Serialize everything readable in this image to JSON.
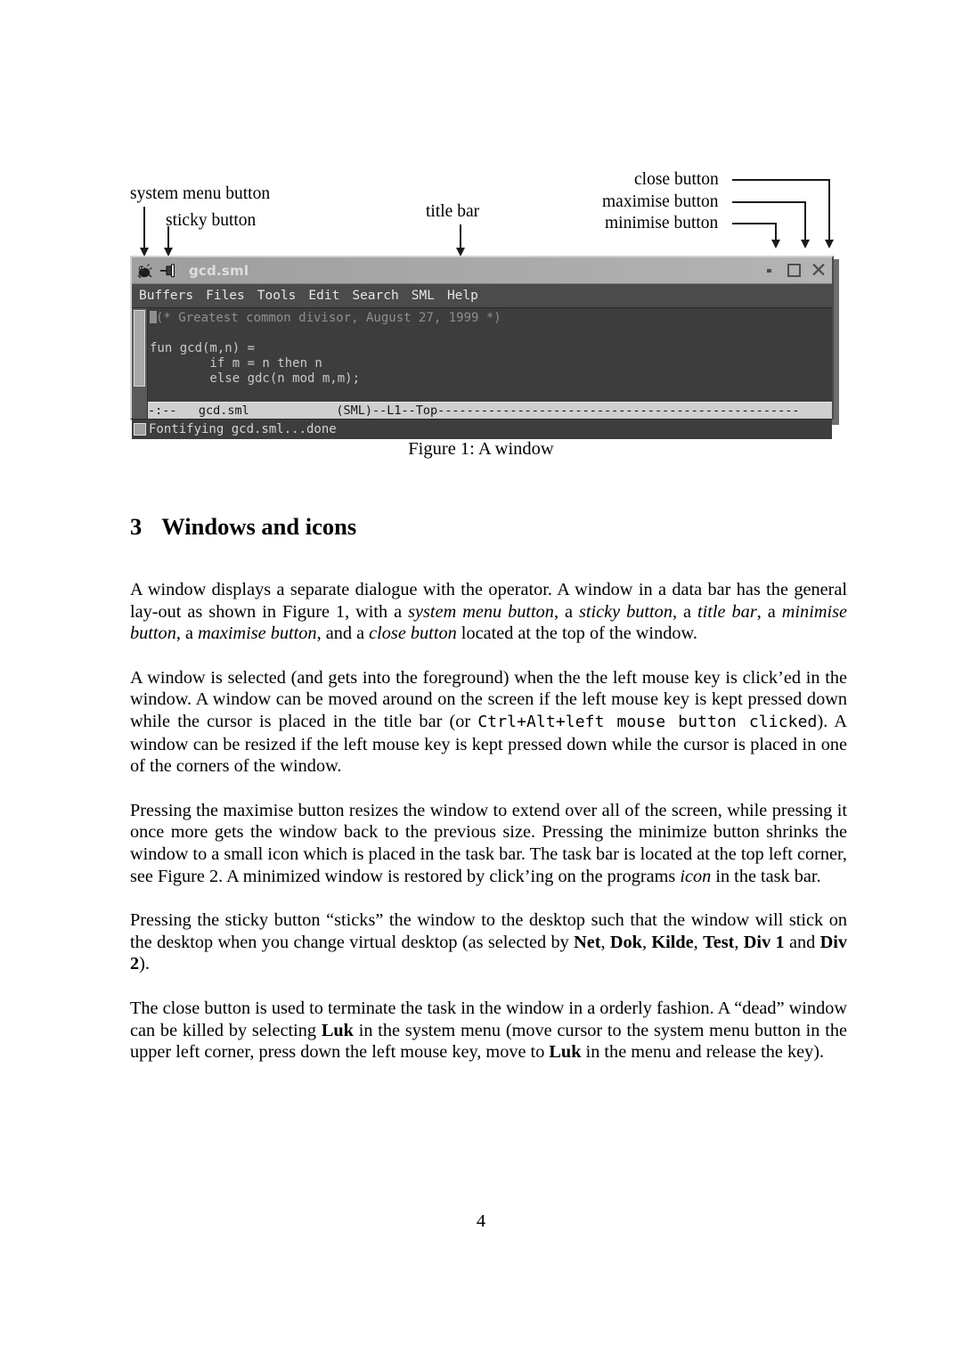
{
  "figure": {
    "annotations": {
      "system_menu": "system menu button",
      "sticky": "sticky button",
      "title_bar": "title bar",
      "close": "close button",
      "maximise": "maximise button",
      "minimise": "minimise button"
    },
    "caption": "Figure 1: A window",
    "window": {
      "title": "gcd.sml",
      "sysmenu_icon": "gnu-emacs-icon",
      "sticky_icon": "pushpin-icon",
      "minimise_icon": "minimise-icon",
      "maximise_icon": "maximise-icon",
      "close_icon": "close-icon",
      "menus": [
        "Buffers",
        "Files",
        "Tools",
        "Edit",
        "Search",
        "SML",
        "Help"
      ],
      "code": {
        "comment": "(* Greatest common divisor, August 27, 1999 *)",
        "lines": [
          "fun gcd(m,n) =",
          "        if m = n then n",
          "        else gdc(n mod m,m);"
        ]
      },
      "modeline": "-:--   gcd.sml            (SML)--L1--Top--------------------------------------------------",
      "minibuffer": "Fontifying gcd.sml...done"
    }
  },
  "section": {
    "number": "3",
    "title": "Windows and icons"
  },
  "paragraphs": {
    "p1": {
      "a": "A window displays a separate dialogue with the operator. A window in a data bar has the general lay-out as shown in Figure 1, with a ",
      "i1": "system menu button",
      "b": ", a ",
      "i2": "sticky button",
      "c": ", a ",
      "i3": "title bar",
      "d": ", a ",
      "i4": "minimise button",
      "e": ", a ",
      "i5": "maximise button",
      "f": ", and a ",
      "i6": "close button",
      "g": " located at the top of the window."
    },
    "p2": {
      "a": "A window is selected (and gets into the foreground) when the the left mouse key is click’ed in the window. A window can be moved around on the screen if the left mouse key is kept pressed down while the cursor is placed in the title bar (or ",
      "mono": "Ctrl+Alt+left mouse button clicked",
      "b": "). A window can be resized if the left mouse key is kept pressed down while the cursor is placed in one of the corners of the window."
    },
    "p3": {
      "a": "Pressing the maximise button resizes the window to extend over all of the screen, while pressing it once more gets the window back to the previous size. Pressing the minimize button shrinks the window to a small icon which is placed in the task bar. The task bar is located at the top left corner, see Figure 2. A minimized window is restored by click’ing on the programs ",
      "i1": "icon",
      "b": " in the task bar."
    },
    "p4": {
      "a": "Pressing the sticky button “sticks” the window to the desktop such that the window will stick on the desktop when you change virtual desktop (as selected by ",
      "b1": "Net",
      "b": ", ",
      "b2": "Dok",
      "c": ", ",
      "b3": "Kilde",
      "d": ", ",
      "b4": "Test",
      "e": ", ",
      "b5": "Div 1",
      "f": " and ",
      "b6": "Div 2",
      "g": ")."
    },
    "p5": {
      "a": "The close button is used to terminate the task in the window in a orderly fashion. A “dead” window can be killed by selecting ",
      "b1": "Luk",
      "b": " in the system menu (move cursor to the system menu button in the upper left corner, press down the left mouse key, move to ",
      "b2": "Luk",
      "c": " in the menu and release the key)."
    }
  },
  "page_number": "4"
}
